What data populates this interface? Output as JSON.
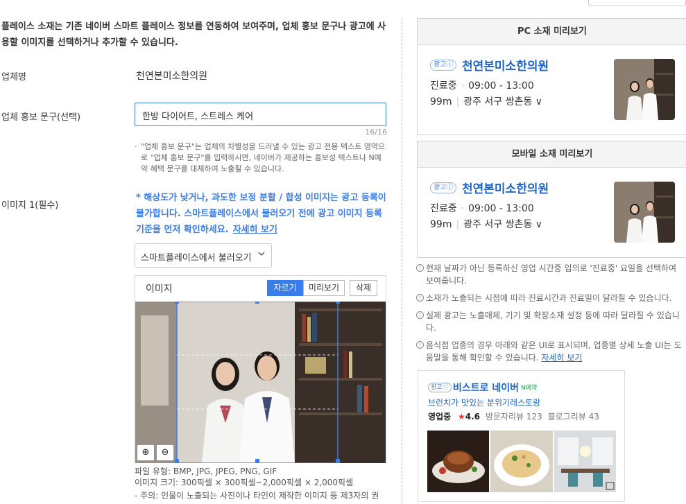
{
  "intro_text": "플레이스 소재는 기존 네이버 스마트 플레이스 정보를 연동하여 보여주며, 업체 홍보 문구나 광고에 사용할 이미지를 선택하거나 추가할 수 있습니다.",
  "fields": {
    "business_name_label": "업체명",
    "business_name_value": "천연본미소한의원",
    "promo_label": "업체 홍보 문구(선택)",
    "promo_value": "한방 다이어트, 스트레스 케어",
    "promo_counter": "16/16",
    "promo_note_bullet": "·",
    "promo_note": "\"업체 홍보 문구\"는 업체의 차별성을 드러낼 수 있는 광고 전용 텍스트 영역으로 \"업체 홍보 문구\"를 입력하시면, 네이버가 제공하는 홍보성 텍스트나 N예약 혜택 문구를 대체하여 노출될 수 있습니다.",
    "image_label": "이미지 1(필수)",
    "image_warning": "* 해상도가 낮거나, 과도한 보정 분할 / 합성 이미지는 광고 등록이 불가합니다. 스마트플레이스에서 불러오기 전에 광고 이미지 등록 기준을 먼저 확인하세요.",
    "image_warning_link": "자세히 보기",
    "load_select": "스마트플레이스에서 불러오기",
    "load_select_chevron": "chevron-down-icon"
  },
  "image_editor": {
    "title": "이미지",
    "crop_label": "자르기",
    "preview_label": "미리보기",
    "delete_label": "삭제",
    "zoom_in": "⊕",
    "zoom_out": "⊖",
    "file_types": "파일 유형: BMP, JPG, JPEG, PNG, GIF",
    "image_size": "이미지 크기: 300픽셀 × 300픽셀~2,000픽셀 × 2,000픽셀",
    "caution": "- 주의: 인물이 노출되는 사진이나 타인이 제작한 이미지 등 제3자의 권"
  },
  "pc_preview": {
    "header": "PC 소재 미리보기",
    "ad_badge": "광고ⓘ",
    "name": "천연본미소한의원",
    "status": "진료중",
    "hours": "09:00 - 13:00",
    "distance": "99m",
    "address": "광주 서구 쌍촌동",
    "chevron": "∨"
  },
  "mobile_preview": {
    "header": "모바일 소재 미리보기",
    "ad_badge": "광고ⓘ",
    "name": "천연본미소한의원",
    "status": "진료중",
    "hours": "09:00 - 13:00",
    "distance": "99m",
    "address": "광주 서구 쌍촌동",
    "chevron": "∨"
  },
  "notices": [
    "현재 날짜가 아닌 등록하신 영업 시간중 임의로 '진료중' 요일을 선택하여 보여줍니다.",
    "소재가 노출되는 시점에 따라 진료시간과 진료일이 달라질 수 있습니다.",
    "실제 광고는 노출매체, 기기 및 확장소재 설정 등에 따라 달라질 수 있습니다.",
    "음식점 업종의 경우 아래와 같은 UI로 표시되며, 업종별 상세 노출 UI는 도움말을 통해 확인할 수 있습니다."
  ],
  "notices_link": "자세히 보기",
  "notice_icon": "!",
  "example_card": {
    "ad_badge": "광고ⓘ",
    "name": "비스트로 네이버",
    "reserve_badge": "N예약",
    "promo": "브런치가 맛있는 분위기레스토랑",
    "status": "영업중",
    "star": "★",
    "rating": "4.6",
    "visitor_reviews": "방문자리뷰 123",
    "blog_reviews": "블로그리뷰 43"
  },
  "colors": {
    "accent": "#3a7de9",
    "link": "#1d64c8",
    "border": "#cfcfcf"
  }
}
